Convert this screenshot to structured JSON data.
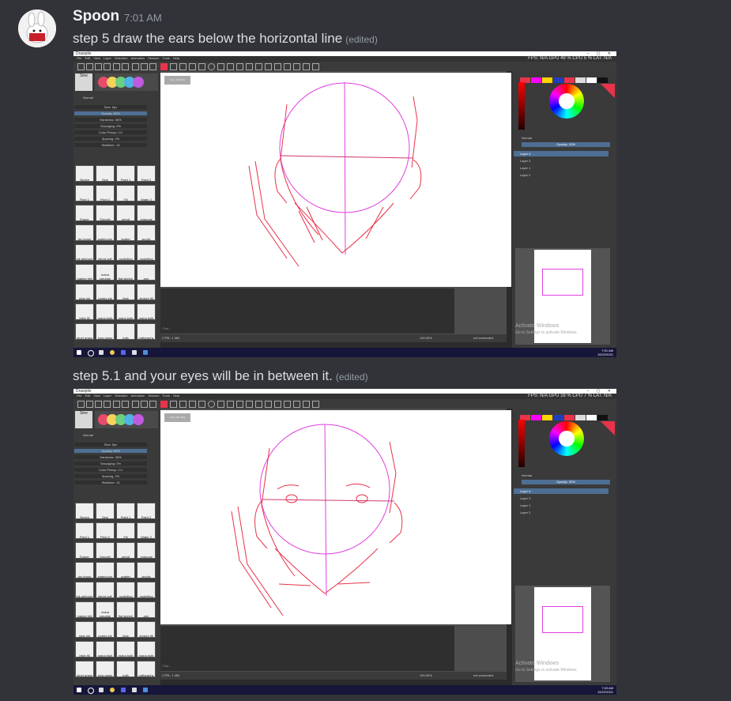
{
  "message": {
    "username": "Spoon",
    "timestamp": "7:01 AM",
    "edited_label": "(edited)",
    "messages": [
      {
        "text": "step 5 draw the ears below the horizontal line"
      },
      {
        "text": "step 5.1 and your eyes will be in between it."
      }
    ]
  },
  "app": {
    "title": "Drawpile",
    "menu": [
      "File",
      "Edit",
      "View",
      "Layer",
      "Selection",
      "Animation",
      "Session",
      "Tools",
      "Help"
    ],
    "stats_label": "FPS: N/A  GPU 49 %  CPU 5 %  LAT: N/A",
    "brush_name": "Sine",
    "blend_mode": "Normal",
    "opacity_label": "Opacity: 20%",
    "sliders": [
      "Size: 5px",
      "Opacity: 60%",
      "Hardness: 36%",
      "Smudging: 0%",
      "Color Pickup: 1/1",
      "Spacing: 2%",
      "Stabilizer: 15"
    ],
    "layers": [
      "Layer 4",
      "Layer 3",
      "Layer 1",
      "Layer 2"
    ],
    "zoom": "100.00%",
    "status_left": "CTRL: 1 MB",
    "status_right": "not connected",
    "view_label": "View 100.00%",
    "chat_placeholder": "Chat...",
    "brush_presets": [
      "Sketch",
      "Sine",
      "Paint 1",
      "Paint 2",
      "Pixel 1",
      "Pixel 2",
      "Fill",
      "Water 2",
      "Eraser",
      "Smooth",
      "pencil",
      "charcoal",
      "dry brush",
      "watercolor",
      "scatter",
      "acrylic",
      "ink airbrush",
      "blend soft",
      "modelling",
      "modelling",
      "marker felt",
      "mana smudge",
      "flat sketch",
      "pen",
      "slow ink",
      "poetry ink",
      "blob",
      "texture fill",
      "inkle fill",
      "mana bulb",
      "mana bulb",
      "mana bulb",
      "short grass",
      "long grass",
      "bulb",
      "calligraphy"
    ],
    "watermark_title": "Activate Windows",
    "watermark_sub": "Go to Settings to activate Windows.",
    "clock_time": "7:01 AM",
    "clock_date": "10/22/2021",
    "screenshot2_clock_time": "7:03 AM",
    "screenshot2_stats_label": "FPS: N/A  GPU 16 %  CPU 7 %  LAT: N/A"
  },
  "colors": {
    "sketch_pink": "#e040e0",
    "sketch_red": "#e8334a",
    "layer_active": "#4e6f93",
    "taskbar": "#16163a"
  }
}
